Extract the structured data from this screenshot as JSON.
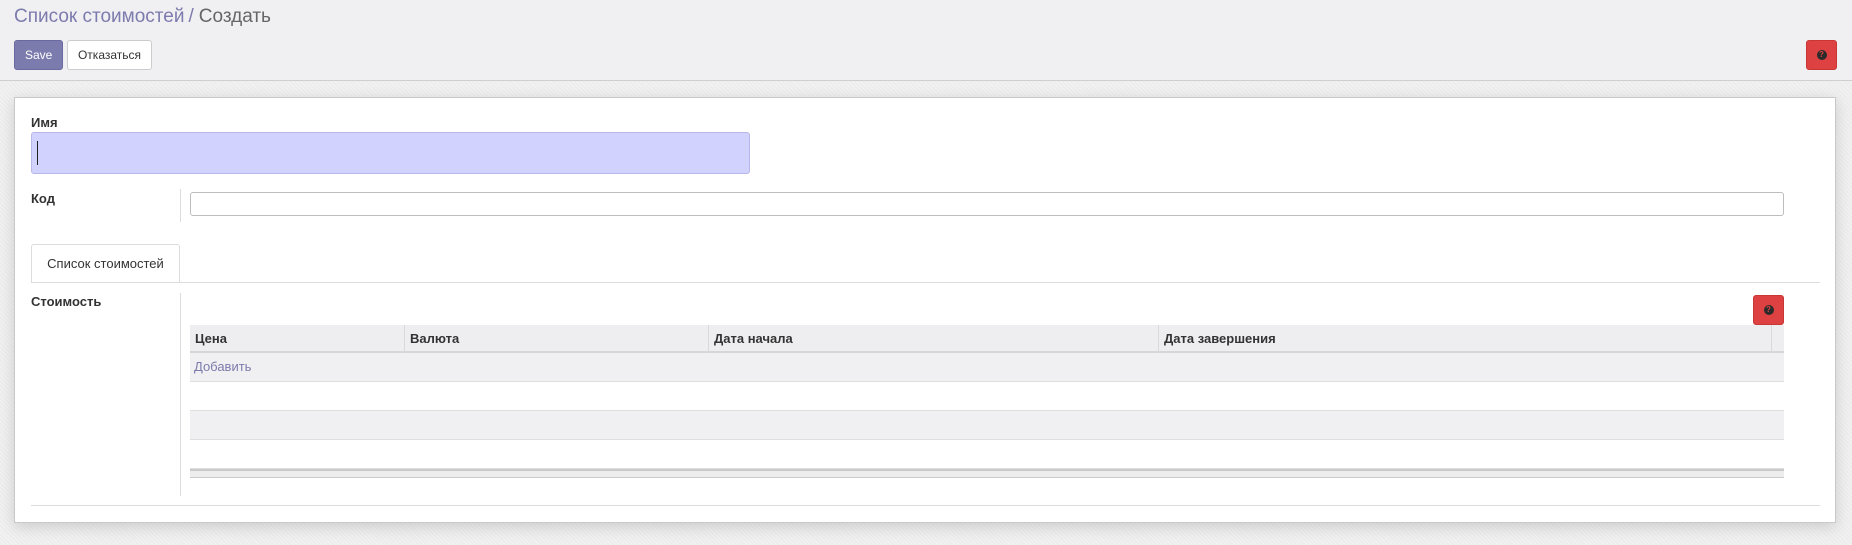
{
  "breadcrumb": {
    "parent": "Список стоимостей",
    "separator": "/",
    "current": "Создать"
  },
  "toolbar": {
    "save_label": "Save",
    "discard_label": "Отказаться",
    "help_icon": "question-circle-icon"
  },
  "form": {
    "name_label": "Имя",
    "name_value": "",
    "code_label": "Код",
    "code_value": "",
    "tabs": [
      {
        "label": "Список стоимостей",
        "active": true
      }
    ],
    "cost_label": "Стоимость"
  },
  "table": {
    "columns": [
      "Цена",
      "Валюта",
      "Дата начала",
      "Дата завершения"
    ],
    "add_label": "Добавить",
    "rows": []
  },
  "colors": {
    "accent": "#7c7bad",
    "danger": "#dd4141",
    "focus_input": "#d2d2ff"
  }
}
